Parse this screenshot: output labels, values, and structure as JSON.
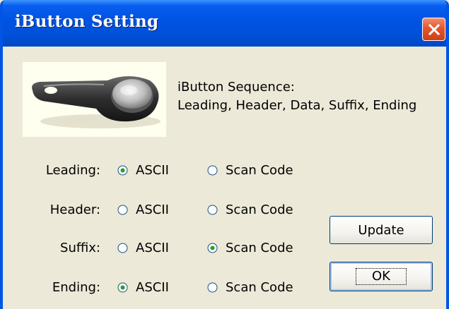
{
  "window": {
    "title": "iButton Setting"
  },
  "info": {
    "sequence_title": "iButton Sequence:",
    "sequence_value": "Leading, Header, Data, Suffix, Ending"
  },
  "rows": [
    {
      "label": "Leading:",
      "selected": "ascii",
      "ascii_label": "ASCII",
      "scan_label": "Scan Code"
    },
    {
      "label": "Header:",
      "selected": "none",
      "ascii_label": "ASCII",
      "scan_label": "Scan Code"
    },
    {
      "label": "Suffix:",
      "selected": "scan",
      "ascii_label": "ASCII",
      "scan_label": "Scan Code"
    },
    {
      "label": "Ending:",
      "selected": "ascii",
      "ascii_label": "ASCII",
      "scan_label": "Scan Code"
    }
  ],
  "buttons": {
    "update": "Update",
    "ok": "OK"
  },
  "colors": {
    "title_bar": "#0054e3",
    "window_bg": "#ece9d8",
    "close_button": "#e3552f",
    "button_border": "#003c74"
  }
}
